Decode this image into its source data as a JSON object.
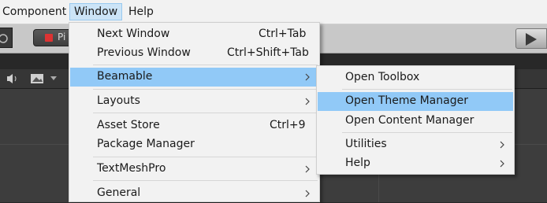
{
  "menubar": {
    "items": [
      {
        "label": "Component"
      },
      {
        "label": "Window"
      },
      {
        "label": "Help"
      }
    ]
  },
  "toolbar": {
    "partial_button_label": "Pi"
  },
  "window_menu": {
    "items": [
      {
        "label": "Next Window",
        "shortcut": "Ctrl+Tab"
      },
      {
        "label": "Previous Window",
        "shortcut": "Ctrl+Shift+Tab"
      },
      {
        "label": "Beamable",
        "submenu_icon": "chevron-right-icon"
      },
      {
        "label": "Layouts",
        "submenu_icon": "chevron-right-icon"
      },
      {
        "label": "Asset Store",
        "shortcut": "Ctrl+9"
      },
      {
        "label": "Package Manager"
      },
      {
        "label": "TextMeshPro",
        "submenu_icon": "chevron-right-icon"
      },
      {
        "label": "General",
        "submenu_icon": "chevron-right-icon"
      }
    ]
  },
  "beamable_menu": {
    "items": [
      {
        "label": "Open Toolbox"
      },
      {
        "label": "Open Theme Manager"
      },
      {
        "label": "Open Content Manager"
      },
      {
        "label": "Utilities",
        "submenu_icon": "chevron-right-icon"
      },
      {
        "label": "Help",
        "submenu_icon": "chevron-right-icon"
      }
    ]
  },
  "colors": {
    "menu_background": "#f2f2f2",
    "highlight": "#91c9f7",
    "active_menubar": "#cce4f7",
    "editor_dark": "#3d3d3d"
  }
}
